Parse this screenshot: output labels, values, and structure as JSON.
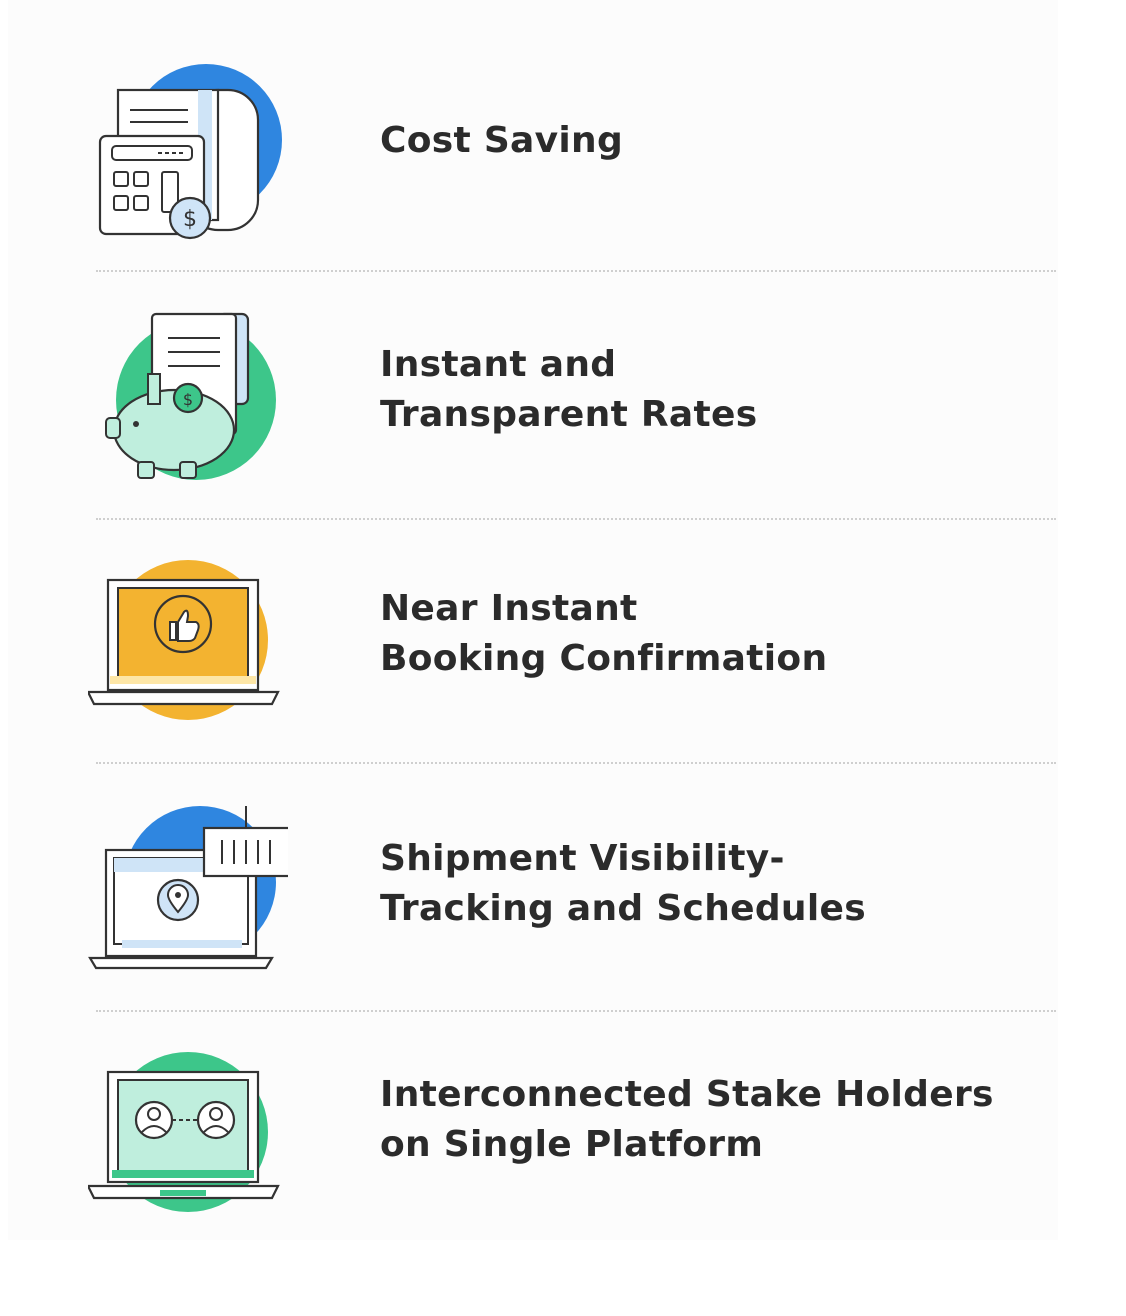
{
  "features": [
    {
      "icon": "calculator-bill-icon",
      "lines": [
        "Cost Saving"
      ],
      "accent": "#2f86e0"
    },
    {
      "icon": "piggy-bank-icon",
      "lines": [
        "Instant and",
        "Transparent Rates"
      ],
      "accent": "#3dc68a"
    },
    {
      "icon": "laptop-thumbs-up-icon",
      "lines": [
        "Near Instant",
        "Booking Confirmation"
      ],
      "accent": "#f3b330"
    },
    {
      "icon": "laptop-location-tracking-icon",
      "lines": [
        "Shipment Visibility-",
        "Tracking and Schedules"
      ],
      "accent": "#2f86e0"
    },
    {
      "icon": "laptop-connected-users-icon",
      "lines": [
        "Interconnected Stake Holders",
        "on Single Platform"
      ],
      "accent": "#3dc68a"
    }
  ]
}
